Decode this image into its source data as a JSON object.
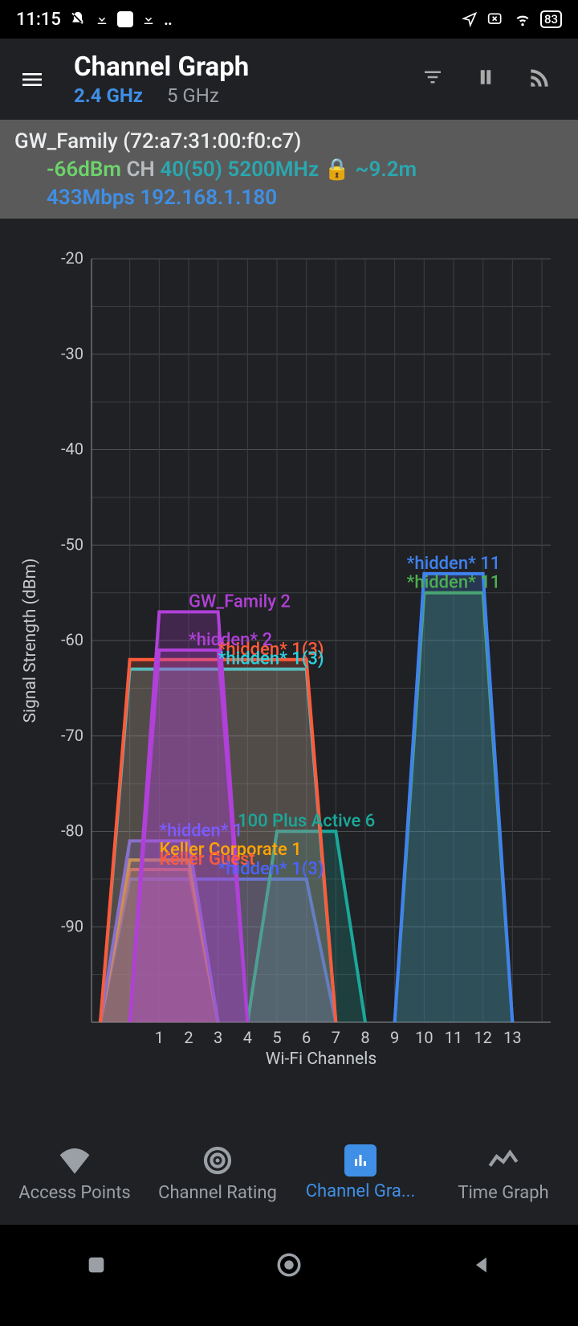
{
  "status": {
    "time": "11:15",
    "battery": "83"
  },
  "header": {
    "title": "Channel Graph",
    "tab_active": "2.4 GHz",
    "tab_inactive": "5 GHz"
  },
  "connection": {
    "ssid": "GW_Family",
    "bssid": "(72:a7:31:00:f0:c7)",
    "dbm": "-66dBm",
    "ch_label": "CH",
    "channel": "40(50)",
    "freq": "5200MHz",
    "distance": "~9.2m",
    "mbps": "433Mbps",
    "ip": "192.168.1.180"
  },
  "chart_data": {
    "type": "area",
    "title": "",
    "xlabel": "Wi-Fi Channels",
    "ylabel": "Signal Strength (dBm)",
    "ylim": [
      -100,
      -20
    ],
    "x_categories": [
      "1",
      "2",
      "3",
      "4",
      "5",
      "6",
      "7",
      "8",
      "9",
      "10",
      "11",
      "12",
      "13"
    ],
    "series": [
      {
        "name": "GW_Family 2",
        "channel": 2,
        "dbm": -57,
        "width": 2,
        "color": "#b040d8"
      },
      {
        "name": "*hidden* 2",
        "channel": 2,
        "dbm": -61,
        "width": 2,
        "color": "#b040d8"
      },
      {
        "name": "*hidden* 1(3)",
        "channel": 3,
        "dbm": -62,
        "width": 6,
        "color": "#ff5b3a"
      },
      {
        "name": "*hidden* 1(3)",
        "channel": 3,
        "dbm": -63,
        "width": 6,
        "color": "#2ad4e0"
      },
      {
        "name": "*hidden* 1",
        "channel": 1,
        "dbm": -81,
        "width": 2,
        "color": "#7a5cff"
      },
      {
        "name": "Keller Corporate 1",
        "channel": 1,
        "dbm": -83,
        "width": 2,
        "color": "#ffa500"
      },
      {
        "name": "Keller Guest",
        "channel": 1,
        "dbm": -84,
        "width": 2,
        "color": "#ff5b3a"
      },
      {
        "name": "*hidden* 1(3)",
        "channel": 3,
        "dbm": -85,
        "width": 6,
        "color": "#4a63ff"
      },
      {
        "name": "100 Plus Active 6",
        "channel": 6,
        "dbm": -80,
        "width": 2,
        "color": "#1aa89a"
      },
      {
        "name": "*hidden* 11",
        "channel": 11,
        "dbm": -53,
        "width": 2,
        "color": "#3f82f0"
      },
      {
        "name": "*hidden* 11",
        "channel": 11,
        "dbm": -55,
        "width": 2,
        "color": "#4caf50"
      }
    ]
  },
  "bottom_tabs": {
    "items": [
      {
        "label": "Access Points"
      },
      {
        "label": "Channel Rating"
      },
      {
        "label": "Channel Gra..."
      },
      {
        "label": "Time Graph"
      }
    ],
    "active_index": 2
  }
}
